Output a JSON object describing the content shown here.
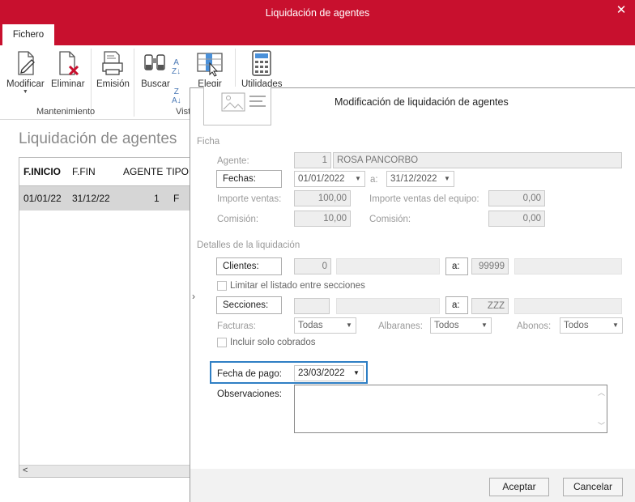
{
  "window": {
    "title": "Liquidación de agentes",
    "tab": "Fichero"
  },
  "ribbon": {
    "buttons": [
      {
        "label": "Modificar",
        "icon": "edit-document-icon"
      },
      {
        "label": "Eliminar",
        "icon": "delete-document-icon"
      },
      {
        "label": "Emisión",
        "icon": "print-icon"
      },
      {
        "label": "Buscar",
        "icon": "binoculars-icon"
      },
      {
        "label": "Elegir",
        "icon": "choose-columns-icon"
      },
      {
        "label": "Utilidades",
        "icon": "calculator-icon"
      }
    ],
    "groups": {
      "mantenimiento": "Mantenimiento",
      "vista": "Vist"
    }
  },
  "list": {
    "title": "Liquidación de agentes",
    "columns": [
      "F.INICIO",
      "F.FIN",
      "AGENTE",
      "TIPO"
    ],
    "rows": [
      [
        "01/01/22",
        "31/12/22",
        "1",
        "F"
      ]
    ]
  },
  "dialog": {
    "title": "Modificación de liquidación de agentes",
    "ficha": {
      "section": "Ficha",
      "agente_label": "Agente:",
      "agente_code": "1",
      "agente_name": "ROSA PANCORBO",
      "fechas_button": "Fechas:",
      "fecha_desde": "01/01/2022",
      "a_label": "a:",
      "fecha_hasta": "31/12/2022",
      "importe_ventas_label": "Importe ventas:",
      "importe_ventas": "100,00",
      "importe_equipo_label": "Importe ventas del equipo:",
      "importe_equipo": "0,00",
      "comision_label": "Comisión:",
      "comision": "10,00",
      "comision_equipo_label": "Comisión:",
      "comision_equipo": "0,00"
    },
    "detalles": {
      "section": "Detalles de la liquidación",
      "clientes_button": "Clientes:",
      "cliente_desde": "0",
      "a_button": "a:",
      "cliente_hasta": "99999",
      "limitar_label": "Limitar el listado entre secciones",
      "secciones_button": "Secciones:",
      "seccion_a_button": "a:",
      "seccion_hasta": "ZZZ",
      "facturas_label": "Facturas:",
      "facturas_value": "Todas",
      "albaranes_label": "Albaranes:",
      "albaranes_value": "Todos",
      "abonos_label": "Abonos:",
      "abonos_value": "Todos",
      "incluir_label": "Incluir solo cobrados"
    },
    "pago": {
      "fecha_pago_label": "Fecha de pago:",
      "fecha_pago": "23/03/2022",
      "observaciones_label": "Observaciones:",
      "observaciones": ""
    },
    "buttons": {
      "accept": "Aceptar",
      "cancel": "Cancelar"
    }
  },
  "colors": {
    "titlebar": "#c8102e",
    "focus": "#2f7fc4"
  }
}
